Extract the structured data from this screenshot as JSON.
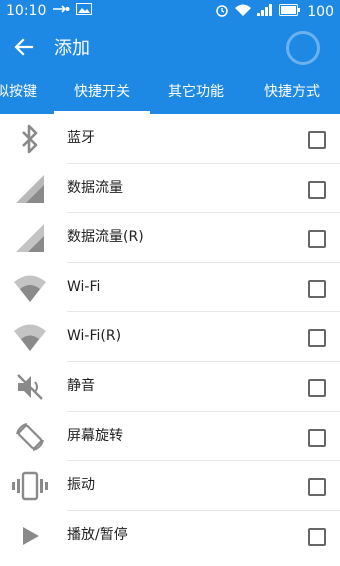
{
  "status": {
    "time": "10:10",
    "battery": "100"
  },
  "appbar": {
    "title": "添加",
    "back_icon": "arrow-back-icon"
  },
  "tabs": [
    {
      "label": "拟按键",
      "active": false
    },
    {
      "label": "快捷开关",
      "active": true
    },
    {
      "label": "其它功能",
      "active": false
    },
    {
      "label": "快捷方式",
      "active": false
    }
  ],
  "items": [
    {
      "label": "蓝牙",
      "icon": "bluetooth-icon",
      "checked": false
    },
    {
      "label": "数据流量",
      "icon": "signal-icon",
      "checked": false
    },
    {
      "label": "数据流量(R)",
      "icon": "signal-r-icon",
      "checked": false
    },
    {
      "label": "Wi-Fi",
      "icon": "wifi-icon",
      "checked": false
    },
    {
      "label": "Wi-Fi(R)",
      "icon": "wifi-r-icon",
      "checked": false
    },
    {
      "label": "静音",
      "icon": "mute-icon",
      "checked": false
    },
    {
      "label": "屏幕旋转",
      "icon": "rotate-icon",
      "checked": false
    },
    {
      "label": "振动",
      "icon": "vibrate-icon",
      "checked": false
    },
    {
      "label": "播放/暂停",
      "icon": "play-icon",
      "checked": false
    }
  ],
  "colors": {
    "primary": "#1e88e5",
    "icon": "#8a8a8a"
  }
}
